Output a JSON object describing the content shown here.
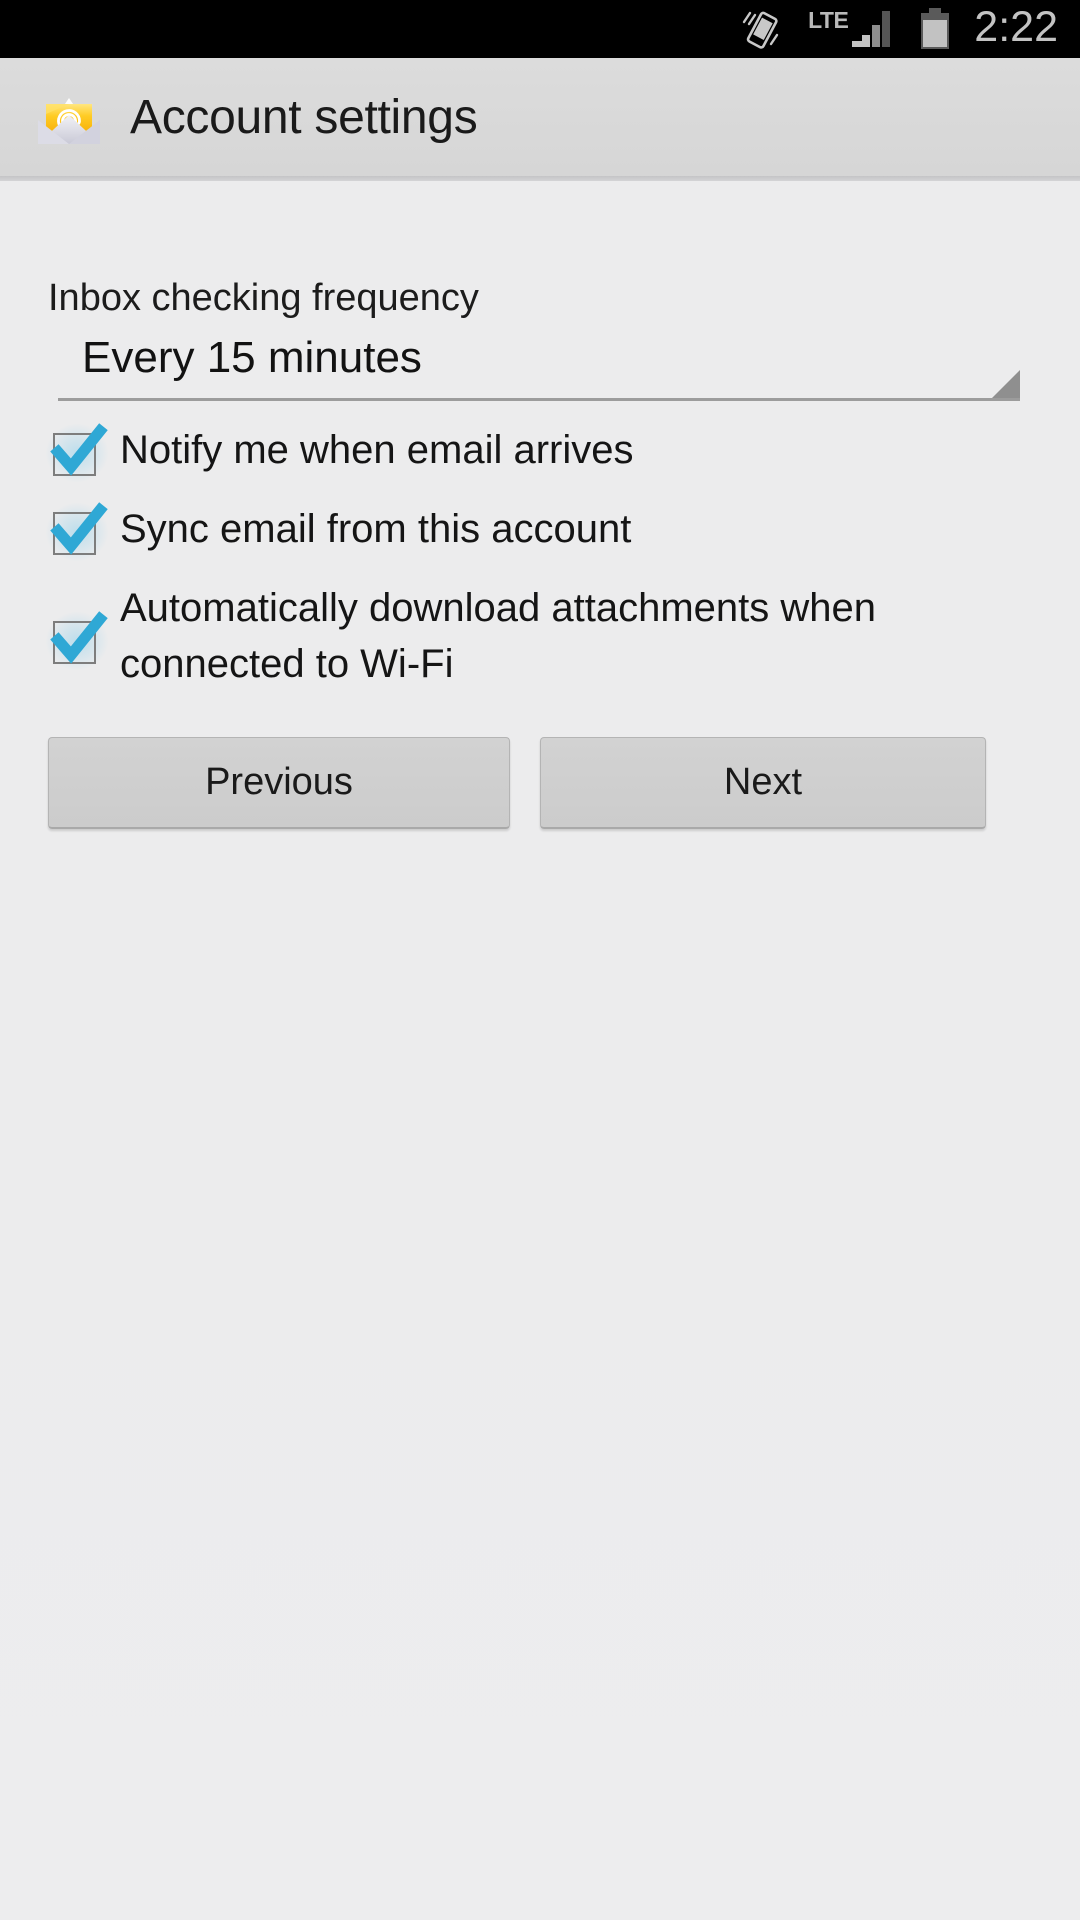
{
  "status_bar": {
    "vibrate_icon": "vibrate-phone-icon",
    "network_label": "LTE",
    "signal_icon": "signal-bars-icon",
    "battery_icon": "battery-icon",
    "clock": "2:22"
  },
  "action_bar": {
    "app_icon": "email-envelope-at-icon",
    "title": "Account settings"
  },
  "settings": {
    "frequency_label": "Inbox checking frequency",
    "frequency_value": "Every 15 minutes",
    "spinner_arrow_icon": "dropdown-triangle-icon",
    "checkboxes": [
      {
        "label": "Notify me when email arrives",
        "checked": true
      },
      {
        "label": "Sync email from this account",
        "checked": true
      },
      {
        "label": "Automatically download attachments when connected to Wi-Fi",
        "checked": true
      }
    ]
  },
  "buttons": {
    "previous": "Previous",
    "next": "Next"
  },
  "colors": {
    "accent_check": "#2fa8d5",
    "status_bar_bg": "#000000",
    "action_bar_bg": "#d8d8d8",
    "content_bg": "#ececed"
  }
}
